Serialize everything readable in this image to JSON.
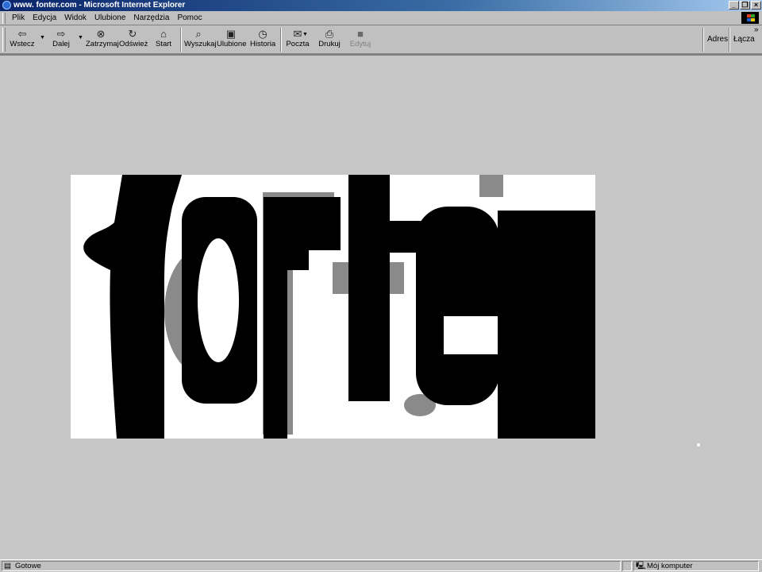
{
  "window": {
    "title": "www. fonter.com - Microsoft Internet Explorer"
  },
  "menu": [
    "Plik",
    "Edycja",
    "Widok",
    "Ulubione",
    "Narzędzia",
    "Pomoc"
  ],
  "toolbar": {
    "back": "Wstecz",
    "forward": "Dalej",
    "stop": "Zatrzymaj",
    "refresh": "Odśwież",
    "home": "Start",
    "search": "Wyszukaj",
    "favorites": "Ulubione",
    "history": "Historia",
    "mail": "Poczta",
    "print": "Drukuj",
    "edit": "Edytuj",
    "address_label": "Adres",
    "links_label": "Łącza",
    "chevron": "»"
  },
  "icons": {
    "back": "back-arrow-icon",
    "forward": "forward-arrow-icon",
    "stop": "stop-icon",
    "refresh": "refresh-icon",
    "home": "home-icon",
    "search": "search-icon",
    "favorites": "favorites-folder-icon",
    "history": "history-icon",
    "mail": "mail-icon",
    "print": "printer-icon",
    "edit": "edit-icon"
  },
  "page": {
    "logo_text": "fonter"
  },
  "status": {
    "left": "Gotowe",
    "zone": "Mój komputer"
  },
  "colors": {
    "titlebar_start": "#0a246a",
    "titlebar_end": "#a6caf0",
    "chrome": "#c0c0c0",
    "content_bg": "#c6c6c6"
  }
}
